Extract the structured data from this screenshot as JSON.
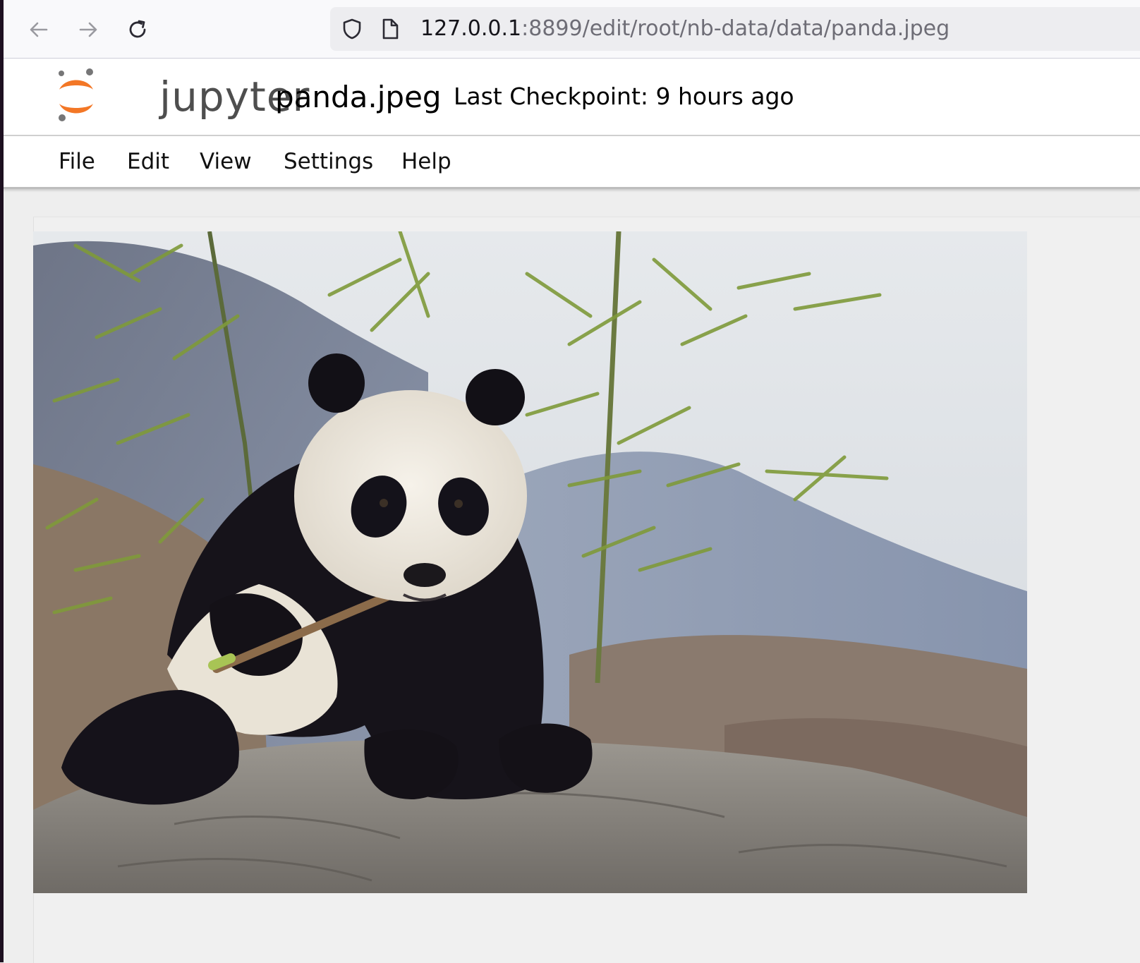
{
  "browser": {
    "url_host": "127.0.0.1",
    "url_path": ":8899/edit/root/nb-data/data/panda.jpeg",
    "icons": [
      "back-arrow-icon",
      "forward-arrow-icon",
      "reload-icon",
      "shield-icon",
      "page-icon"
    ]
  },
  "header": {
    "logo_text": "jupyter",
    "document_title": "panda.jpeg",
    "checkpoint": "Last Checkpoint: 9 hours ago"
  },
  "menu": {
    "items": [
      "File",
      "Edit",
      "View",
      "Settings",
      "Help"
    ]
  },
  "colors": {
    "jupyter_orange": "#F37726",
    "logo_gray": "#767677"
  }
}
